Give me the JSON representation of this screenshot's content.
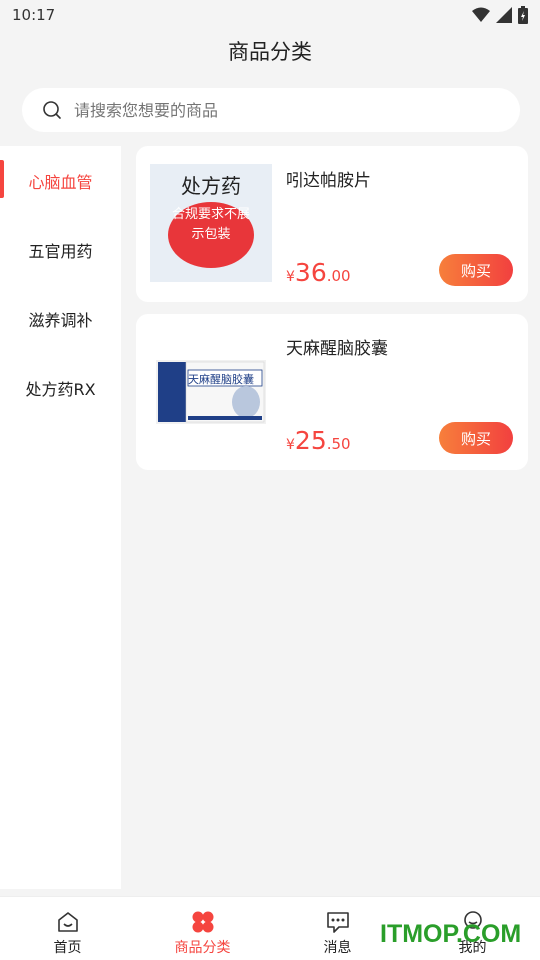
{
  "status": {
    "time": "10:17"
  },
  "header": {
    "title": "商品分类"
  },
  "search": {
    "placeholder": "请搜索您想要的商品"
  },
  "sidebar": {
    "items": [
      {
        "label": "心脑血管",
        "active": true
      },
      {
        "label": "五官用药",
        "active": false
      },
      {
        "label": "滋养调补",
        "active": false
      },
      {
        "label": "处方药RX",
        "active": false
      }
    ]
  },
  "products": [
    {
      "name": "吲达帕胺片",
      "rx_label": "处方药",
      "rx_notice": "合规要求不展示包装",
      "price_yen": "¥",
      "price_int": "36",
      "price_dec": ".00",
      "buy_label": "购买"
    },
    {
      "name": "天麻醒脑胶囊",
      "package_text": "天麻醒脑胶囊",
      "price_yen": "¥",
      "price_int": "25",
      "price_dec": ".50",
      "buy_label": "购买"
    }
  ],
  "tabbar": {
    "items": [
      {
        "label": "首页",
        "icon": "home-icon"
      },
      {
        "label": "商品分类",
        "icon": "category-icon",
        "active": true
      },
      {
        "label": "消息",
        "icon": "message-icon"
      },
      {
        "label": "我的",
        "icon": "profile-icon"
      }
    ]
  },
  "watermark": {
    "text": "ITMOP.COM"
  },
  "colors": {
    "accent": "#f5453f",
    "button_from": "#f77f3b",
    "button_to": "#f2403f"
  }
}
